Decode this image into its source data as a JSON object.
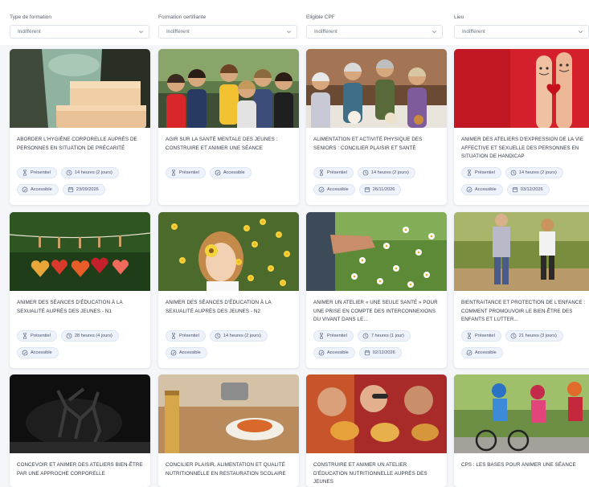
{
  "filters": [
    {
      "label": "Type de formation",
      "value": "Indifférent"
    },
    {
      "label": "Formation certifiante",
      "value": "Indifférent"
    },
    {
      "label": "Eligible CPF",
      "value": "Indifférent"
    },
    {
      "label": "Lieu",
      "value": "Indifférent"
    }
  ],
  "cards": [
    {
      "title": "Aborder l'hygiène corporelle auprès de personnes en situation de précarité",
      "image": "soap-bars-photo",
      "chips": [
        {
          "icon": "hourglass-icon",
          "text": "Présentiel"
        },
        {
          "icon": "clock-icon",
          "text": "14 heures (2 jours)"
        },
        {
          "icon": "accessible-icon",
          "text": "Accessible"
        },
        {
          "icon": "calendar-icon",
          "text": "23/09/2026"
        }
      ]
    },
    {
      "title": "Agir sur la santé mentale des jeunes : construire et animer une séance",
      "image": "group-of-young-people-photo",
      "chips": [
        {
          "icon": "hourglass-icon",
          "text": "Présentiel"
        },
        {
          "icon": "accessible-icon",
          "text": "Accessible"
        }
      ]
    },
    {
      "title": "Alimentation et activité physique des seniors : concilier plaisir et santé",
      "image": "seniors-eating-together-photo",
      "chips": [
        {
          "icon": "hourglass-icon",
          "text": "Présentiel"
        },
        {
          "icon": "clock-icon",
          "text": "14 heures (2 jours)"
        },
        {
          "icon": "accessible-icon",
          "text": "Accessible"
        },
        {
          "icon": "calendar-icon",
          "text": "26/11/2026"
        }
      ]
    },
    {
      "title": "Animer des ateliers d'expression de la vie affective et sexuelle des personnes en situation de handicap",
      "image": "finger-couple-heart-photo",
      "chips": [
        {
          "icon": "hourglass-icon",
          "text": "Présentiel"
        },
        {
          "icon": "clock-icon",
          "text": "14 heures (2 jours)"
        },
        {
          "icon": "accessible-icon",
          "text": "Accessible"
        },
        {
          "icon": "calendar-icon",
          "text": "03/12/2026"
        }
      ]
    },
    {
      "title": "Animer des séances d'éducation à la sexualité auprès des jeunes - N1",
      "image": "hearts-on-clothesline-photo",
      "chips": [
        {
          "icon": "hourglass-icon",
          "text": "Présentiel"
        },
        {
          "icon": "clock-icon",
          "text": "28 heures (4 jours)"
        },
        {
          "icon": "accessible-icon",
          "text": "Accessible"
        }
      ]
    },
    {
      "title": "Animer des séances d'éducation à la sexualité auprès des jeunes - N2",
      "image": "girl-with-flowers-photo",
      "chips": [
        {
          "icon": "hourglass-icon",
          "text": "Présentiel"
        },
        {
          "icon": "clock-icon",
          "text": "14 heures (2 jours)"
        },
        {
          "icon": "accessible-icon",
          "text": "Accessible"
        }
      ]
    },
    {
      "title": "Animer un atelier « Une seule santé » pour une prise en compte des interconnexions du vivant dans le...",
      "image": "hand-picking-daisy-photo",
      "chips": [
        {
          "icon": "hourglass-icon",
          "text": "Présentiel"
        },
        {
          "icon": "clock-icon",
          "text": "7 heures (1 jour)"
        },
        {
          "icon": "accessible-icon",
          "text": "Accessible"
        },
        {
          "icon": "calendar-icon",
          "text": "02/12/2026"
        }
      ]
    },
    {
      "title": "Bientraitance et protection de l'enfance : comment promouvoir le bien-être des enfants et lutter...",
      "image": "children-walking-photo",
      "chips": [
        {
          "icon": "hourglass-icon",
          "text": "Présentiel"
        },
        {
          "icon": "clock-icon",
          "text": "21 heures (3 jours)"
        },
        {
          "icon": "accessible-icon",
          "text": "Accessible"
        }
      ]
    },
    {
      "title": "Concevoir et animer des ateliers bien-être par une approche corporelle",
      "image": "dancers-silhouette-photo",
      "chips": []
    },
    {
      "title": "Concilier plaisir, alimentation et qualité nutritionnelle en restauration scolaire",
      "image": "cooking-pasta-photo",
      "chips": []
    },
    {
      "title": "Construire et animer un atelier d'éducation nutritionnelle auprès des jeunes",
      "image": "friends-eating-burgers-photo",
      "chips": []
    },
    {
      "title": "CPS : les bases pour animer une séance",
      "image": "kids-on-bikes-photo",
      "chips": []
    }
  ],
  "colors": {
    "background": "#f4f6fa",
    "card": "#ffffff",
    "chip_bg": "#eef3fb",
    "chip_text": "#47506a"
  }
}
